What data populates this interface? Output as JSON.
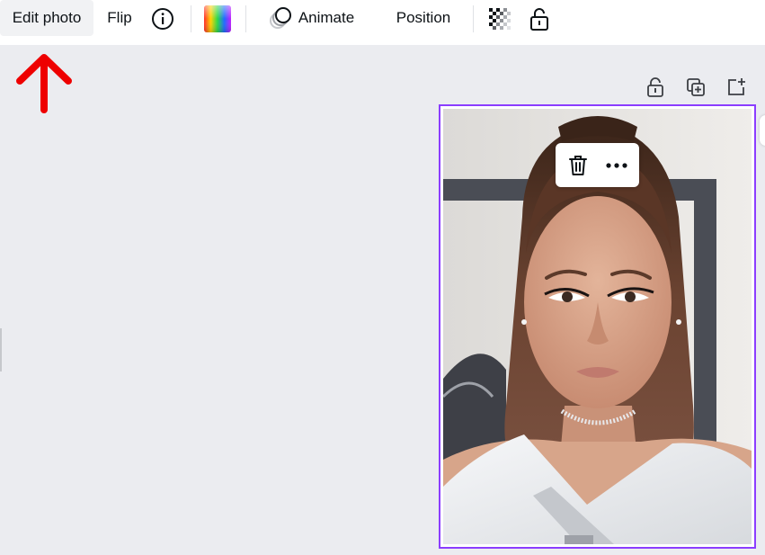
{
  "toolbar": {
    "edit_photo_label": "Edit photo",
    "flip_label": "Flip",
    "animate_label": "Animate",
    "position_label": "Position"
  },
  "icons": {
    "info": "info-icon",
    "color": "color-picker-icon",
    "animate": "animate-icon",
    "transparency": "transparency-icon",
    "lock": "lock-icon",
    "page_lock": "page-lock-icon",
    "duplicate": "duplicate-page-icon",
    "add_page": "add-page-icon",
    "delete": "trash-icon",
    "more": "more-icon",
    "arrow": "red-arrow-annotation"
  },
  "colors": {
    "selection": "#8b3dff",
    "arrow": "#ee0000",
    "canvas_bg": "#ebecf0"
  }
}
